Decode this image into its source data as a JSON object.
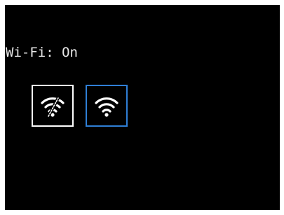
{
  "status": {
    "label": "Wi-Fi: On"
  },
  "buttons": [
    {
      "id": "wifi-off",
      "icon": "wifi-slash-icon",
      "border_color": "#ffffff"
    },
    {
      "id": "wifi-on",
      "icon": "wifi-icon",
      "border_color": "#2f7fd6",
      "selected": true
    }
  ],
  "colors": {
    "background": "#000000",
    "text": "#e8e8e8",
    "accent": "#2f7fd6"
  }
}
